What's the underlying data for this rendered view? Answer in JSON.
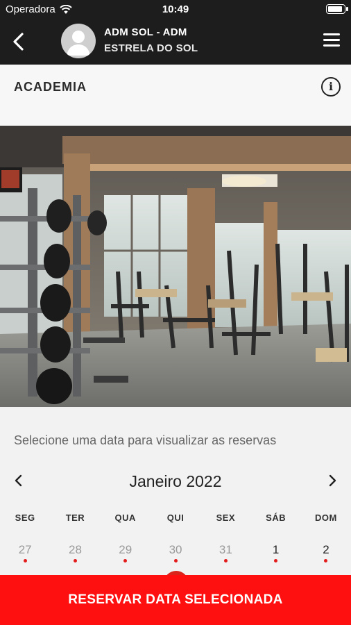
{
  "status_bar": {
    "carrier": "Operadora",
    "time": "10:49"
  },
  "header": {
    "title": "ADM SOL - ADM",
    "subtitle": "ESTRELA DO SOL"
  },
  "section": {
    "title": "ACADEMIA"
  },
  "calendar": {
    "prompt": "Selecione uma data para visualizar as reservas",
    "month_label": "Janeiro 2022",
    "weekdays": [
      "SEG",
      "TER",
      "QUA",
      "QUI",
      "SEX",
      "SÁB",
      "DOM"
    ],
    "days": [
      "27",
      "28",
      "29",
      "30",
      "31",
      "1",
      "2"
    ],
    "prev_arrow": "‹",
    "next_arrow": "›"
  },
  "cta": {
    "label": "RESERVAR DATA SELECIONADA"
  },
  "colors": {
    "header_bg": "#1d1d1d",
    "accent": "#ff1010",
    "dot": "#e31b1b"
  }
}
